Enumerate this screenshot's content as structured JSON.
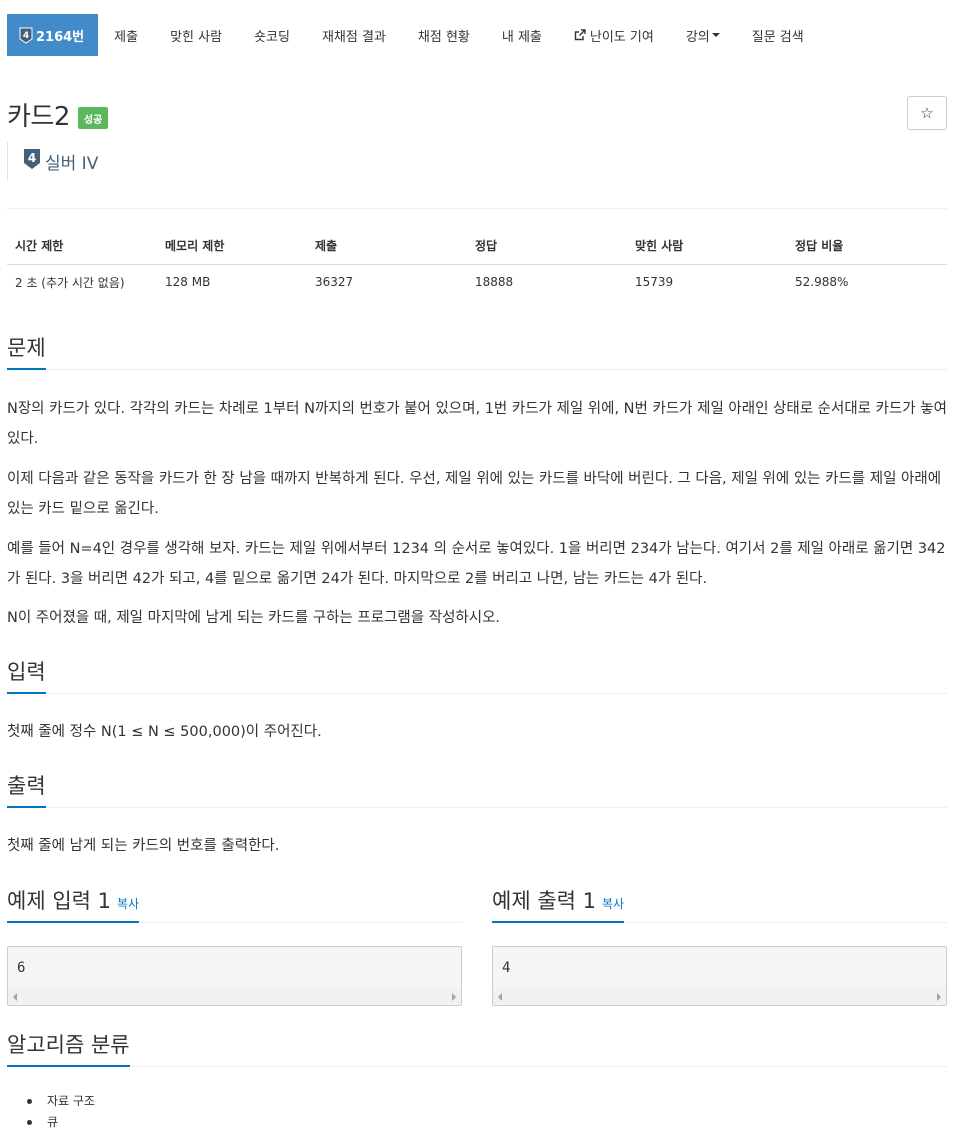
{
  "nav": {
    "active_tab": "2164번",
    "tier_badge": "4",
    "tabs": [
      "제출",
      "맞힌 사람",
      "숏코딩",
      "재채점 결과",
      "채점 현황",
      "내 제출",
      "난이도 기여",
      "강의",
      "질문 검색"
    ]
  },
  "problem": {
    "title": "카드2",
    "result_badge": "성공",
    "star_icon": "☆",
    "tier_number": "4",
    "tier_name": "실버 IV",
    "tier_color": "#435f7a"
  },
  "stats": {
    "headers": [
      "시간 제한",
      "메모리 제한",
      "제출",
      "정답",
      "맞힌 사람",
      "정답 비율"
    ],
    "values": [
      "2 초 (추가 시간 없음)",
      "128 MB",
      "36327",
      "18888",
      "15739",
      "52.988%"
    ]
  },
  "sections": {
    "description_title": "문제",
    "description": [
      "N장의 카드가 있다. 각각의 카드는 차례로 1부터 N까지의 번호가 붙어 있으며, 1번 카드가 제일 위에, N번 카드가 제일 아래인 상태로 순서대로 카드가 놓여 있다.",
      "이제 다음과 같은 동작을 카드가 한 장 남을 때까지 반복하게 된다. 우선, 제일 위에 있는 카드를 바닥에 버린다. 그 다음, 제일 위에 있는 카드를 제일 아래에 있는 카드 밑으로 옮긴다.",
      "예를 들어 N=4인 경우를 생각해 보자. 카드는 제일 위에서부터 1234 의 순서로 놓여있다. 1을 버리면 234가 남는다. 여기서 2를 제일 아래로 옮기면 342가 된다. 3을 버리면 42가 되고, 4를 밑으로 옮기면 24가 된다. 마지막으로 2를 버리고 나면, 남는 카드는 4가 된다.",
      "N이 주어졌을 때, 제일 마지막에 남게 되는 카드를 구하는 프로그램을 작성하시오."
    ],
    "input_title": "입력",
    "input_text": "첫째 줄에 정수 N(1 ≤ N ≤ 500,000)이 주어진다.",
    "output_title": "출력",
    "output_text": "첫째 줄에 남게 되는 카드의 번호를 출력한다.",
    "sample_input_title": "예제 입력 1",
    "sample_output_title": "예제 출력 1",
    "copy_label": "복사",
    "sample_input_value": "6",
    "sample_output_value": "4",
    "tags_title": "알고리즘 분류",
    "tags": [
      "자료 구조",
      "큐"
    ]
  },
  "colors": {
    "active_tab_bg": "#428bca",
    "success_label": "#5cb85c",
    "headline_underline": "#0076c0"
  }
}
